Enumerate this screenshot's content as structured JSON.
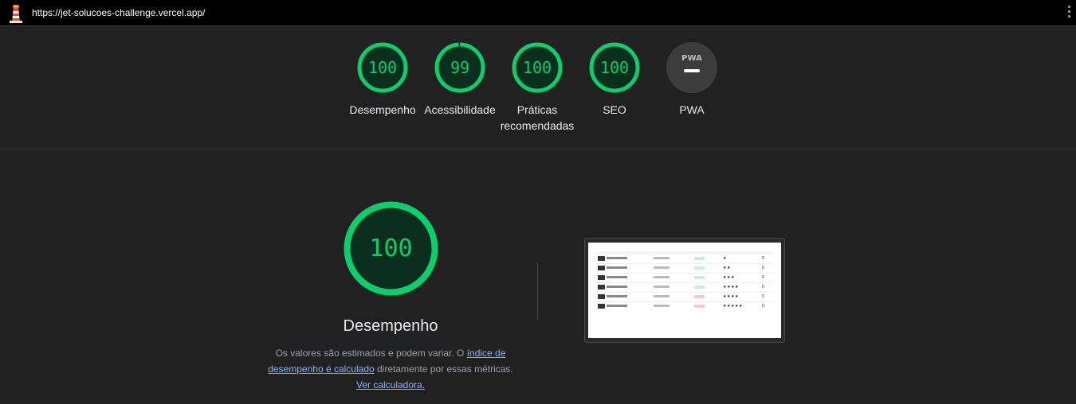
{
  "topbar": {
    "url": "https://jet-solucoes-challenge.vercel.app/",
    "logo_icon": "lighthouse-icon",
    "menu_icon": "kebab-menu-icon"
  },
  "gauges": [
    {
      "id": "desempenho",
      "score": "100",
      "value": 1.0,
      "label": "Desempenho"
    },
    {
      "id": "acessibilidade",
      "score": "99",
      "value": 0.99,
      "label": "Acessibilidade"
    },
    {
      "id": "praticas",
      "score": "100",
      "value": 1.0,
      "label": "Práticas\nrecomendadas"
    },
    {
      "id": "seo",
      "score": "100",
      "value": 1.0,
      "label": "SEO"
    },
    {
      "id": "pwa",
      "score": "",
      "value": 0,
      "label": "PWA",
      "badge": "PWA"
    }
  ],
  "performance": {
    "score": "100",
    "value": 1.0,
    "title": "Desempenho",
    "desc_1": "Os valores são estimados e podem variar. O ",
    "link_1": "índice de desempenho é calculado",
    "desc_2": " diretamente por essas métricas. ",
    "link_2": "Ver calculadora."
  },
  "colors": {
    "pass": "#0cce6b",
    "pass_bg": "#0b2f1e",
    "bg": "#212121",
    "link": "#8ab4f8",
    "neutral": "#3c3c3c"
  },
  "screenshot": {
    "rows": [
      {
        "status_color": "#c8f0d2",
        "rating": "★"
      },
      {
        "status_color": "#c8f0d2",
        "rating": "★★"
      },
      {
        "status_color": "#c8f0d2",
        "rating": "★★★"
      },
      {
        "status_color": "#c8f0d2",
        "rating": "★★★★"
      },
      {
        "status_color": "#f8c8c8",
        "rating": "★★★★"
      },
      {
        "status_color": "#f8c8c8",
        "rating": "★★★★★"
      }
    ]
  }
}
